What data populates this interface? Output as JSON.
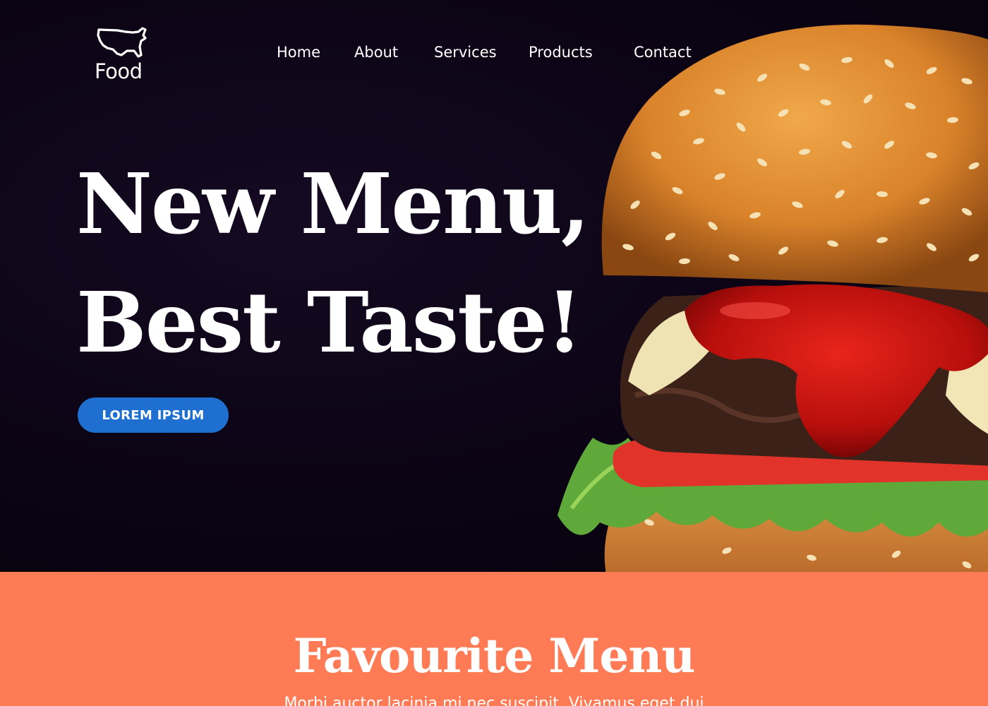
{
  "brand": {
    "logo_text": "Food",
    "logo_icon": "usa-map-icon"
  },
  "nav": {
    "items": [
      {
        "label": "Home"
      },
      {
        "label": "About"
      },
      {
        "label": "Services"
      },
      {
        "label": "Products"
      },
      {
        "label": "Contact"
      }
    ]
  },
  "hero": {
    "headline_line1": "New Menu,",
    "headline_line2": "Best Taste!",
    "cta_label": "LOREM IPSUM",
    "image": "burger-image"
  },
  "favourite": {
    "title": "Favourite Menu",
    "text": "Morbi auctor lacinia mi nec suscipit. Vivamus eget dui"
  },
  "colors": {
    "hero_bg": "#0b0414",
    "cta": "#1f6fd0",
    "section_bg": "#ff7b56",
    "text": "#ffffff"
  }
}
